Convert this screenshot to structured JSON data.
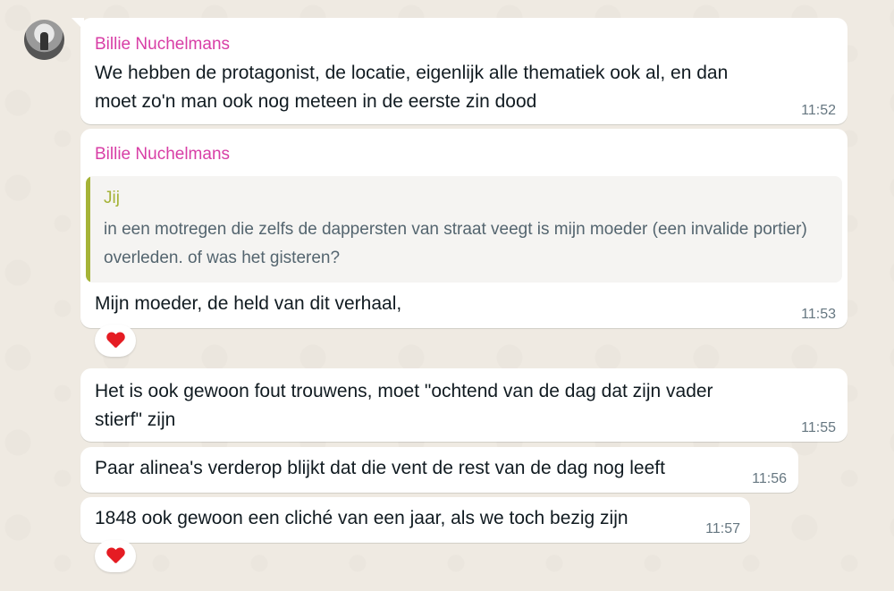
{
  "messages": [
    {
      "sender": "Billie Nuchelmans",
      "text": "We hebben de protagonist, de locatie, eigenlijk alle thematiek ook al, en dan\nmoet zo'n man ook nog meteen in de eerste zin dood",
      "time": "11:52"
    },
    {
      "sender": "Billie Nuchelmans",
      "quote": {
        "author": "Jij",
        "text": "in een motregen die zelfs de dappersten van straat veegt is mijn moeder (een invalide portier) overleden. of was het gisteren?"
      },
      "text": "Mijn moeder, de held van dit verhaal,",
      "time": "11:53",
      "reaction": "heart"
    },
    {
      "text": "Het is ook gewoon fout trouwens, moet \"ochtend van de dag dat zijn vader\nstierf\" zijn",
      "time": "11:55"
    },
    {
      "text": "Paar alinea's verderop blijkt dat die vent de rest van de dag nog leeft",
      "time": "11:56"
    },
    {
      "text": "1848 ook gewoon een cliché van een jaar, als we toch bezig zijn",
      "time": "11:57",
      "reaction": "heart"
    }
  ],
  "colors": {
    "background": "#efeae2",
    "bubble": "#ffffff",
    "sender_name": "#d83ea6",
    "quote_author": "#a5b337",
    "timestamp": "#667781"
  }
}
